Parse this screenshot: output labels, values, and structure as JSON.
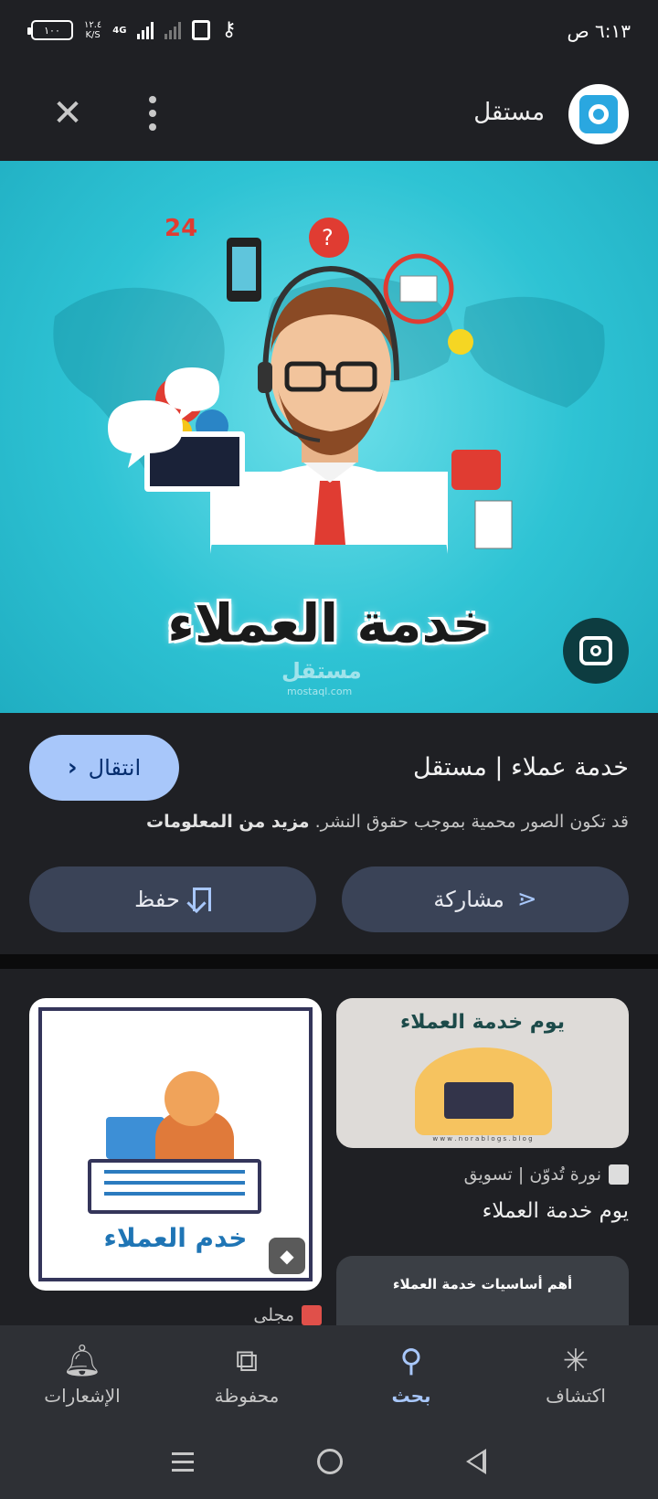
{
  "status_bar": {
    "time": "٦:١٣ ص",
    "battery": "١٠٠",
    "speed": "١٢.٤",
    "speed_unit": "K/S",
    "network": "4G"
  },
  "header": {
    "site_name": "مستقل"
  },
  "hero": {
    "caption": "خدمة العملاء",
    "watermark": "مستقل",
    "watermark_url": "mostaql.com"
  },
  "info": {
    "title": "خدمة عملاء | مستقل",
    "visit_label": "انتقال",
    "copyright_text": "قد تكون الصور محمية بموجب حقوق النشر.",
    "more_info_label": "مزيد من المعلومات",
    "share_label": "مشاركة",
    "save_label": "حفظ"
  },
  "related": {
    "right": [
      {
        "thumb_title": "يوم خدمة العملاء",
        "thumb_url": "w w w . n o r a b l o g s . b l o g",
        "source": "نورة تُدوّن | تسويق",
        "title": "يوم خدمة العملاء"
      },
      {
        "thumb_title": "أهم أساسيات خدمة العملاء"
      }
    ],
    "left": [
      {
        "thumb_caption": "خدم العملاء",
        "source": "مجلى"
      }
    ]
  },
  "bottom_nav": {
    "items": [
      {
        "label": "اكتشاف",
        "icon": "asterisk-icon",
        "active": false
      },
      {
        "label": "بحث",
        "icon": "search-icon",
        "active": true
      },
      {
        "label": "محفوظة",
        "icon": "collections-icon",
        "active": false
      },
      {
        "label": "الإشعارات",
        "icon": "bell-icon",
        "active": false
      }
    ]
  },
  "colors": {
    "background": "#1f2024",
    "accent": "#a8c7fa",
    "pill": "#3a4357",
    "hero": "#2ec3d4"
  }
}
